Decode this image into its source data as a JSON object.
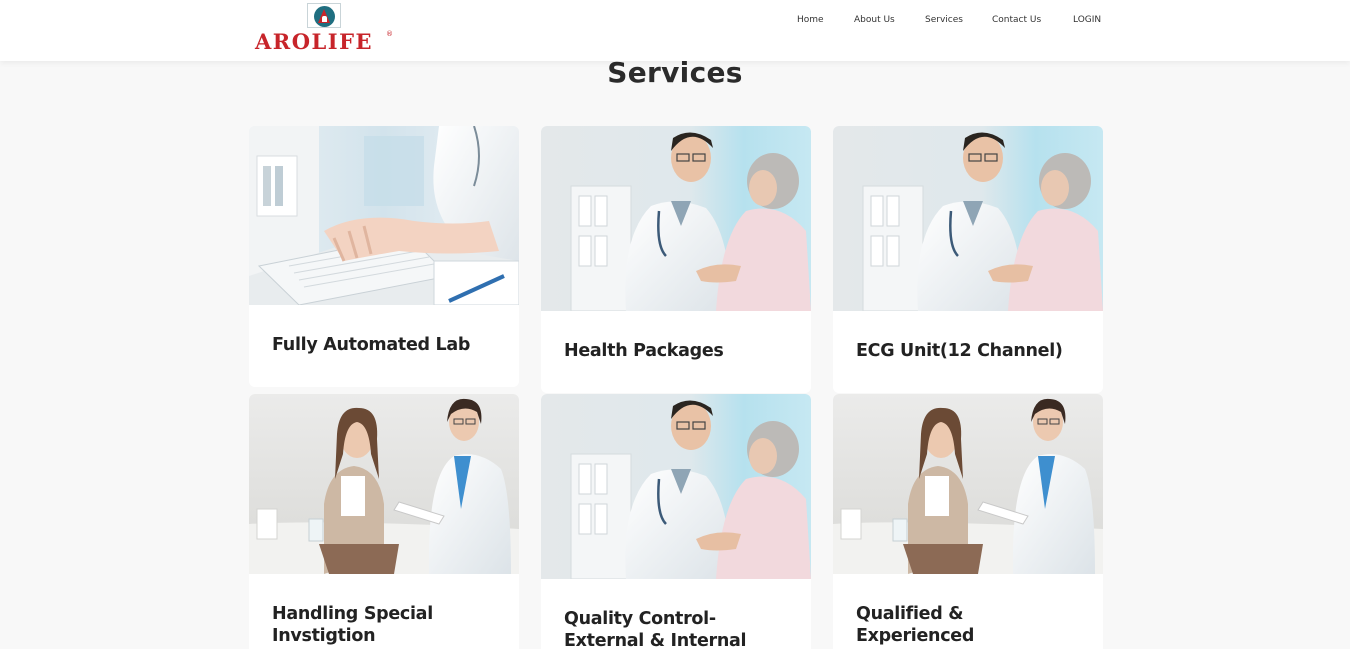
{
  "brand": {
    "name": "AROLIFE",
    "reg_mark": "®",
    "icon": "arolife-logo-icon"
  },
  "nav": {
    "items": [
      {
        "label": "Home"
      },
      {
        "label": "About Us"
      },
      {
        "label": "Services"
      },
      {
        "label": "Contact Us"
      },
      {
        "label": "LOGIN"
      }
    ]
  },
  "page": {
    "title": "Services"
  },
  "services": [
    {
      "title": "Fully Automated Lab",
      "image": "lab-keyboard-photo"
    },
    {
      "title": "Health Packages",
      "image": "doctor-patient-photo"
    },
    {
      "title": "ECG Unit(12 Channel)",
      "image": "doctor-patient-photo"
    },
    {
      "title": "Handling Special Invstigtion",
      "image": "consultation-photo"
    },
    {
      "title": "Quality Control-External & Internal",
      "image": "doctor-patient-photo"
    },
    {
      "title": "Qualified & Experienced Technicians",
      "image": "consultation-photo"
    }
  ],
  "colors": {
    "brand_red": "#c7242a",
    "brand_teal": "#1f6e80",
    "background": "#f8f8f8",
    "card": "#ffffff",
    "text": "#222222"
  }
}
